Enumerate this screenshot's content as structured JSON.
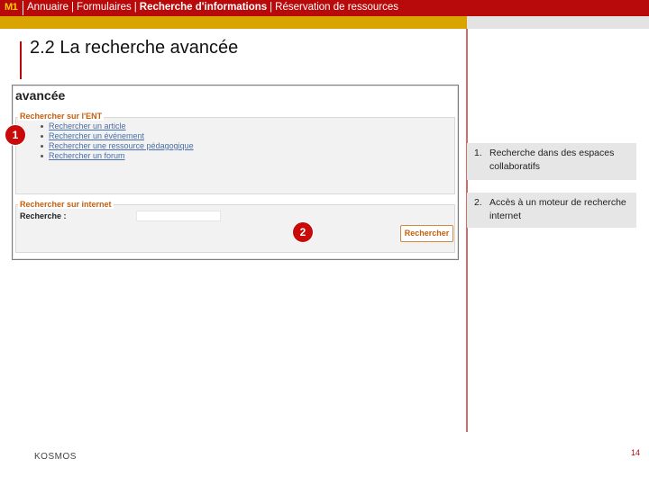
{
  "header": {
    "badge": "M1",
    "nav_items": [
      "Annuaire",
      "Formulaires",
      "Recherche d'informations",
      "Réservation de ressources"
    ],
    "nav_separator": "|",
    "active_nav": "Recherche d'informations"
  },
  "slide": {
    "title": "2.2  La recherche avancée",
    "footer": "KOSMOS",
    "page_number": "14"
  },
  "screenshot": {
    "heading": "avancée",
    "ent_section": {
      "legend": "Rechercher sur l'ENT",
      "links": [
        "Rechercher un article",
        "Rechercher un événement",
        "Rechercher une ressource pédagogique",
        "Rechercher un forum"
      ]
    },
    "web_section": {
      "legend": "Rechercher sur internet",
      "label": "Recherche :",
      "input_value": "",
      "button_label": "Rechercher"
    }
  },
  "markers": [
    "1",
    "2"
  ],
  "notes": [
    {
      "num": "1.",
      "text": "Recherche dans des espaces collaboratifs"
    },
    {
      "num": "2.",
      "text": "Accès à un moteur de recherche internet"
    }
  ],
  "colors": {
    "header_red": "#b80a0a",
    "gold_bar": "#d9a300",
    "legend_orange": "#c65f0c",
    "link_blue": "#4a6fa8",
    "marker_red": "#c80a0a"
  }
}
